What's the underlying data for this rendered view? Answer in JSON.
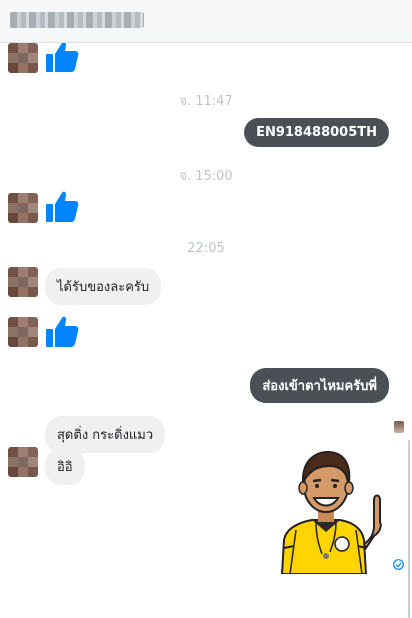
{
  "header": {
    "contact_name": ""
  },
  "messages": [
    {
      "type": "like"
    },
    {
      "type": "timestamp",
      "text": "จ. 11:47"
    },
    {
      "type": "outgoing",
      "text": "EN918488005TH"
    },
    {
      "type": "timestamp",
      "text": "จ. 15:00"
    },
    {
      "type": "like"
    },
    {
      "type": "timestamp",
      "text": "22:05"
    },
    {
      "type": "incoming",
      "text": "ได้รับของละครับ"
    },
    {
      "type": "like"
    },
    {
      "type": "outgoing",
      "text": "ส่องเข้าตาไหมครับพี่"
    },
    {
      "type": "incoming",
      "text": "สุดติ่ง กระดิ่งแมว"
    },
    {
      "type": "incoming",
      "text": "อิอิ"
    },
    {
      "type": "sticker",
      "icon": "thumbs-up-man-sticker"
    }
  ],
  "colors": {
    "like_blue": "#0084ff",
    "outgoing_bubble": "#4b4f56",
    "incoming_bubble": "#f1f0f0",
    "timestamp": "#bec3c9"
  }
}
